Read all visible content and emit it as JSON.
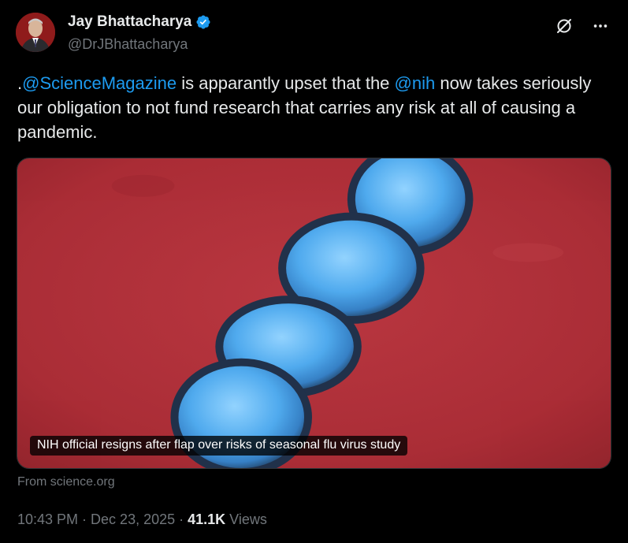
{
  "author": {
    "display_name": "Jay Bhattacharya",
    "handle": "@DrJBhattacharya"
  },
  "tweet": {
    "prefix": ".",
    "mention_1": "@ScienceMagazine",
    "text_1": " is apparantly upset that the ",
    "mention_2": "@nih",
    "text_2": " now takes seriously our obligation to not fund research that carries any risk at all of causing a pandemic."
  },
  "card": {
    "caption": "NIH official resigns after flap over risks of seasonal flu virus study",
    "source": "From science.org"
  },
  "meta": {
    "time": "10:43 PM",
    "separator_1": " · ",
    "date": "Dec 23, 2025",
    "separator_2": " · ",
    "views_count": "41.1K",
    "views_label": " Views"
  },
  "colors": {
    "background": "#000000",
    "text": "#e7e9ea",
    "secondary": "#71767b",
    "accent": "#1d9bf0",
    "image_red": "#b02a36",
    "virus_blue": "#3a9be0"
  },
  "icons": {
    "verified": "verified-badge-icon",
    "grok": "grok-icon",
    "more": "more-icon"
  }
}
